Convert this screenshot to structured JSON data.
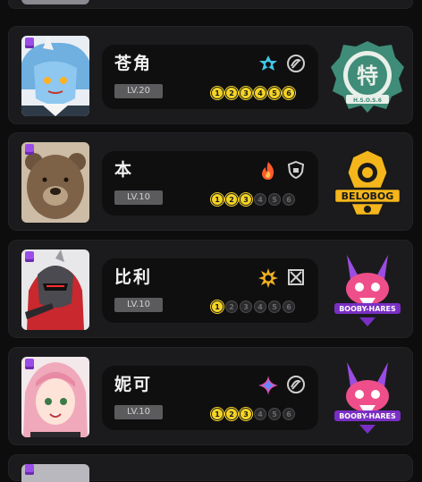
{
  "agents": [
    {
      "name": "苍角",
      "level": "LV.20",
      "attribute_icon": "ice-star-icon",
      "attribute_color": "#3ec8e6",
      "specialty_icon": "support-swirl-icon",
      "skills": [
        {
          "label": "1",
          "on": true
        },
        {
          "label": "2",
          "on": true
        },
        {
          "label": "3",
          "on": true
        },
        {
          "label": "4",
          "on": true
        },
        {
          "label": "5",
          "on": true
        },
        {
          "label": "6",
          "on": true
        }
      ],
      "faction_icon": "section6-emblem-icon",
      "faction_text": "特",
      "faction_sub": "H.S.O.S.6"
    },
    {
      "name": "本",
      "level": "LV.10",
      "attribute_icon": "fire-icon",
      "attribute_color": "#ff5a2a",
      "specialty_icon": "defense-shield-icon",
      "skills": [
        {
          "label": "1",
          "on": true
        },
        {
          "label": "2",
          "on": true
        },
        {
          "label": "3",
          "on": true
        },
        {
          "label": "4",
          "on": false
        },
        {
          "label": "5",
          "on": false
        },
        {
          "label": "6",
          "on": false
        }
      ],
      "faction_icon": "belobog-emblem-icon",
      "faction_text": "BELOBOG"
    },
    {
      "name": "比利",
      "level": "LV.10",
      "attribute_icon": "physical-burst-icon",
      "attribute_color": "#f0b020",
      "specialty_icon": "attack-crosshair-icon",
      "skills": [
        {
          "label": "1",
          "on": true
        },
        {
          "label": "2",
          "on": false
        },
        {
          "label": "3",
          "on": false
        },
        {
          "label": "4",
          "on": false
        },
        {
          "label": "5",
          "on": false
        },
        {
          "label": "6",
          "on": false
        }
      ],
      "faction_icon": "cunning-hares-emblem-icon",
      "faction_text": "BOOBY-HARES"
    },
    {
      "name": "妮可",
      "level": "LV.10",
      "attribute_icon": "ether-sparkle-icon",
      "attribute_color": "#e54fb0",
      "specialty_icon": "support-swirl-icon",
      "skills": [
        {
          "label": "1",
          "on": true
        },
        {
          "label": "2",
          "on": true
        },
        {
          "label": "3",
          "on": true
        },
        {
          "label": "4",
          "on": false
        },
        {
          "label": "5",
          "on": false
        },
        {
          "label": "6",
          "on": false
        }
      ],
      "faction_icon": "cunning-hares-emblem-icon",
      "faction_text": "BOOBY-HARES"
    }
  ]
}
